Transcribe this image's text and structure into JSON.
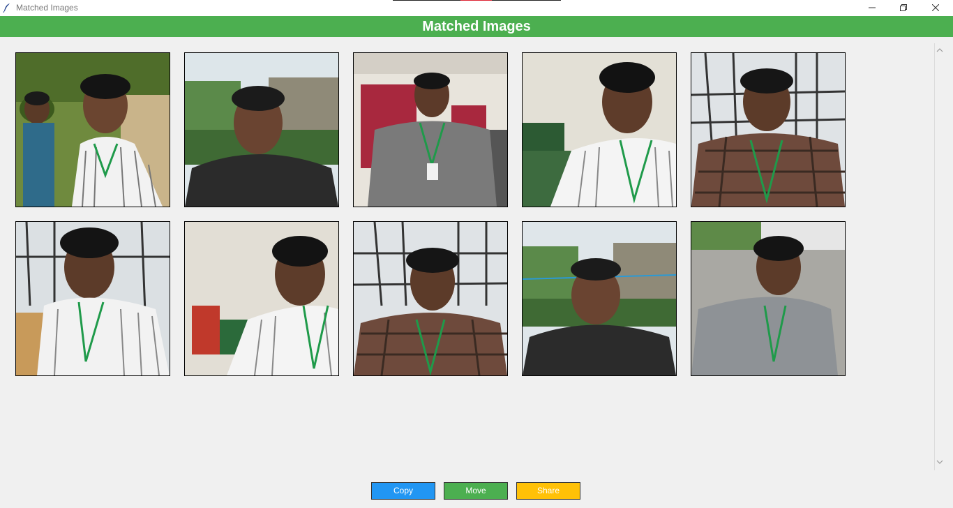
{
  "window": {
    "title": "Matched Images",
    "app_icon": "feather-icon",
    "controls": [
      "minimize-icon",
      "restore-icon",
      "close-icon"
    ]
  },
  "header": {
    "title": "Matched Images",
    "background": "#4caf50"
  },
  "gallery": {
    "images": [
      {
        "alt": "matched-image-1",
        "scene": "outdoor"
      },
      {
        "alt": "matched-image-2",
        "scene": "outdoor"
      },
      {
        "alt": "matched-image-3",
        "scene": "indoor"
      },
      {
        "alt": "matched-image-4",
        "scene": "indoor"
      },
      {
        "alt": "matched-image-5",
        "scene": "indoor"
      },
      {
        "alt": "matched-image-6",
        "scene": "indoor"
      },
      {
        "alt": "matched-image-7",
        "scene": "indoor"
      },
      {
        "alt": "matched-image-8",
        "scene": "indoor"
      },
      {
        "alt": "matched-image-9",
        "scene": "outdoor"
      },
      {
        "alt": "matched-image-10",
        "scene": "outdoor"
      }
    ]
  },
  "actions": {
    "copy_label": "Copy",
    "move_label": "Move",
    "share_label": "Share",
    "copy_color": "#2196f3",
    "move_color": "#4caf50",
    "share_color": "#ffc107"
  }
}
